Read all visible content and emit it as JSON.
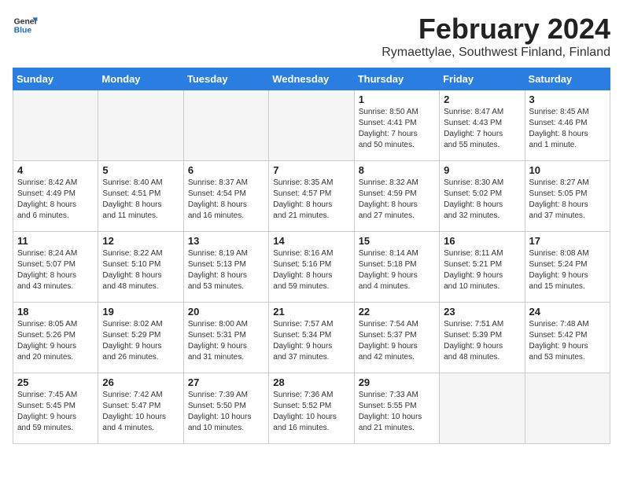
{
  "header": {
    "logo_line1": "General",
    "logo_line2": "Blue",
    "month_year": "February 2024",
    "location": "Rymaettylae, Southwest Finland, Finland"
  },
  "weekdays": [
    "Sunday",
    "Monday",
    "Tuesday",
    "Wednesday",
    "Thursday",
    "Friday",
    "Saturday"
  ],
  "weeks": [
    [
      {
        "day": "",
        "info": ""
      },
      {
        "day": "",
        "info": ""
      },
      {
        "day": "",
        "info": ""
      },
      {
        "day": "",
        "info": ""
      },
      {
        "day": "1",
        "info": "Sunrise: 8:50 AM\nSunset: 4:41 PM\nDaylight: 7 hours\nand 50 minutes."
      },
      {
        "day": "2",
        "info": "Sunrise: 8:47 AM\nSunset: 4:43 PM\nDaylight: 7 hours\nand 55 minutes."
      },
      {
        "day": "3",
        "info": "Sunrise: 8:45 AM\nSunset: 4:46 PM\nDaylight: 8 hours\nand 1 minute."
      }
    ],
    [
      {
        "day": "4",
        "info": "Sunrise: 8:42 AM\nSunset: 4:49 PM\nDaylight: 8 hours\nand 6 minutes."
      },
      {
        "day": "5",
        "info": "Sunrise: 8:40 AM\nSunset: 4:51 PM\nDaylight: 8 hours\nand 11 minutes."
      },
      {
        "day": "6",
        "info": "Sunrise: 8:37 AM\nSunset: 4:54 PM\nDaylight: 8 hours\nand 16 minutes."
      },
      {
        "day": "7",
        "info": "Sunrise: 8:35 AM\nSunset: 4:57 PM\nDaylight: 8 hours\nand 21 minutes."
      },
      {
        "day": "8",
        "info": "Sunrise: 8:32 AM\nSunset: 4:59 PM\nDaylight: 8 hours\nand 27 minutes."
      },
      {
        "day": "9",
        "info": "Sunrise: 8:30 AM\nSunset: 5:02 PM\nDaylight: 8 hours\nand 32 minutes."
      },
      {
        "day": "10",
        "info": "Sunrise: 8:27 AM\nSunset: 5:05 PM\nDaylight: 8 hours\nand 37 minutes."
      }
    ],
    [
      {
        "day": "11",
        "info": "Sunrise: 8:24 AM\nSunset: 5:07 PM\nDaylight: 8 hours\nand 43 minutes."
      },
      {
        "day": "12",
        "info": "Sunrise: 8:22 AM\nSunset: 5:10 PM\nDaylight: 8 hours\nand 48 minutes."
      },
      {
        "day": "13",
        "info": "Sunrise: 8:19 AM\nSunset: 5:13 PM\nDaylight: 8 hours\nand 53 minutes."
      },
      {
        "day": "14",
        "info": "Sunrise: 8:16 AM\nSunset: 5:16 PM\nDaylight: 8 hours\nand 59 minutes."
      },
      {
        "day": "15",
        "info": "Sunrise: 8:14 AM\nSunset: 5:18 PM\nDaylight: 9 hours\nand 4 minutes."
      },
      {
        "day": "16",
        "info": "Sunrise: 8:11 AM\nSunset: 5:21 PM\nDaylight: 9 hours\nand 10 minutes."
      },
      {
        "day": "17",
        "info": "Sunrise: 8:08 AM\nSunset: 5:24 PM\nDaylight: 9 hours\nand 15 minutes."
      }
    ],
    [
      {
        "day": "18",
        "info": "Sunrise: 8:05 AM\nSunset: 5:26 PM\nDaylight: 9 hours\nand 20 minutes."
      },
      {
        "day": "19",
        "info": "Sunrise: 8:02 AM\nSunset: 5:29 PM\nDaylight: 9 hours\nand 26 minutes."
      },
      {
        "day": "20",
        "info": "Sunrise: 8:00 AM\nSunset: 5:31 PM\nDaylight: 9 hours\nand 31 minutes."
      },
      {
        "day": "21",
        "info": "Sunrise: 7:57 AM\nSunset: 5:34 PM\nDaylight: 9 hours\nand 37 minutes."
      },
      {
        "day": "22",
        "info": "Sunrise: 7:54 AM\nSunset: 5:37 PM\nDaylight: 9 hours\nand 42 minutes."
      },
      {
        "day": "23",
        "info": "Sunrise: 7:51 AM\nSunset: 5:39 PM\nDaylight: 9 hours\nand 48 minutes."
      },
      {
        "day": "24",
        "info": "Sunrise: 7:48 AM\nSunset: 5:42 PM\nDaylight: 9 hours\nand 53 minutes."
      }
    ],
    [
      {
        "day": "25",
        "info": "Sunrise: 7:45 AM\nSunset: 5:45 PM\nDaylight: 9 hours\nand 59 minutes."
      },
      {
        "day": "26",
        "info": "Sunrise: 7:42 AM\nSunset: 5:47 PM\nDaylight: 10 hours\nand 4 minutes."
      },
      {
        "day": "27",
        "info": "Sunrise: 7:39 AM\nSunset: 5:50 PM\nDaylight: 10 hours\nand 10 minutes."
      },
      {
        "day": "28",
        "info": "Sunrise: 7:36 AM\nSunset: 5:52 PM\nDaylight: 10 hours\nand 16 minutes."
      },
      {
        "day": "29",
        "info": "Sunrise: 7:33 AM\nSunset: 5:55 PM\nDaylight: 10 hours\nand 21 minutes."
      },
      {
        "day": "",
        "info": ""
      },
      {
        "day": "",
        "info": ""
      }
    ]
  ]
}
